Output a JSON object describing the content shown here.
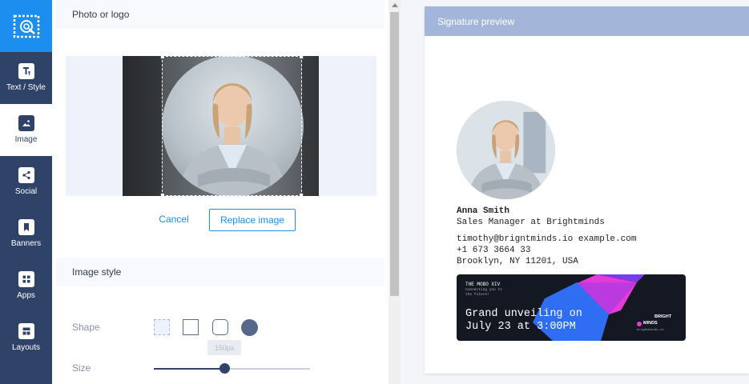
{
  "sidebar": {
    "items": [
      {
        "label": "Text / Style",
        "icon": "text-style-icon"
      },
      {
        "label": "Image",
        "icon": "image-icon"
      },
      {
        "label": "Social",
        "icon": "share-icon"
      },
      {
        "label": "Banners",
        "icon": "bookmark-icon"
      },
      {
        "label": "Apps",
        "icon": "apps-grid-icon"
      },
      {
        "label": "Layouts",
        "icon": "layouts-icon"
      }
    ],
    "active": "Image",
    "accent_color": "#1b8ef0",
    "background_color": "#2f4368"
  },
  "editor": {
    "photo_section_title": "Photo or logo",
    "cancel_label": "Cancel",
    "replace_label": "Replace image",
    "image_style_title": "Image style",
    "shape_label": "Shape",
    "shape_options": [
      "none-dashed",
      "square",
      "rounded",
      "circle"
    ],
    "selected_shape": "circle",
    "size_label": "Size",
    "size_tooltip": "150px",
    "size_fraction": 0.45
  },
  "preview": {
    "header": "Signature preview",
    "name": "Anna Smith",
    "title": "Sales Manager at Brightminds",
    "email": "timothy@brigntminds.io example.com",
    "phone": "+1 673 3664 33",
    "address": "Brooklyn, NY 11201, USA",
    "banner": {
      "event_tag": "THE MOBO XIV",
      "event_sub1": "Connecting you to",
      "event_sub2": "the future!",
      "headline1": "Grand unveiling on",
      "headline2": "July 23 at 3:00PM",
      "brand1": "BRIGHT",
      "brand2": "MINDS",
      "brand_url": "brightminds.io",
      "colors": {
        "magenta": "#e53bd8",
        "blue": "#2f6ef2",
        "background": "#141823"
      }
    }
  }
}
